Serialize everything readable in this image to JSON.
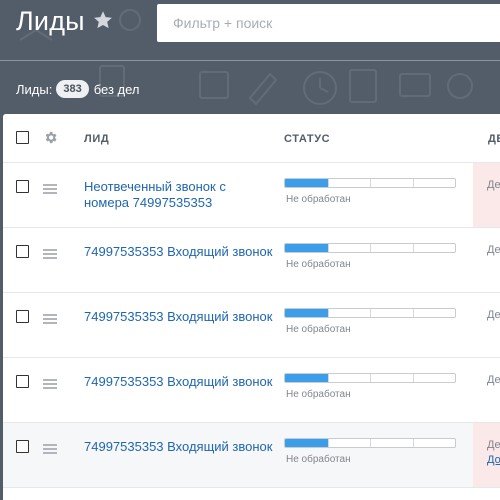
{
  "header": {
    "title": "Лиды",
    "search_placeholder": "Фильтр + поиск",
    "count_label": "Лиды:",
    "count_value": "383",
    "count_suffix": "без дел"
  },
  "grid": {
    "columns": {
      "lead": "ЛИД",
      "status": "СТАТУС",
      "deal": "ДЕ"
    },
    "rows": [
      {
        "title": "Неотвеченный звонок с номера 74997535353",
        "status": "Не обработан",
        "progress": 0.25,
        "deal": "Де",
        "deal_link": "",
        "highlight": true
      },
      {
        "title": "74997535353 Входящий звонок",
        "status": "Не обработан",
        "progress": 0.25,
        "deal": "Де",
        "deal_link": "",
        "highlight": false
      },
      {
        "title": "74997535353 Входящий звонок",
        "status": "Не обработан",
        "progress": 0.25,
        "deal": "Де",
        "deal_link": "",
        "highlight": false
      },
      {
        "title": "74997535353 Входящий звонок",
        "status": "Не обработан",
        "progress": 0.25,
        "deal": "Де",
        "deal_link": "",
        "highlight": false
      },
      {
        "title": "74997535353 Входящий звонок",
        "status": "Не обработан",
        "progress": 0.25,
        "deal": "Де",
        "deal_link": "До",
        "highlight": true
      }
    ]
  },
  "colors": {
    "background": "#535c69",
    "progress_fill": "#3c9de8",
    "link": "#2066b0",
    "deal_highlight": "#fbe8e8"
  },
  "icons": [
    "star-icon",
    "gear-icon",
    "drag-handle-icon",
    "checkbox"
  ]
}
